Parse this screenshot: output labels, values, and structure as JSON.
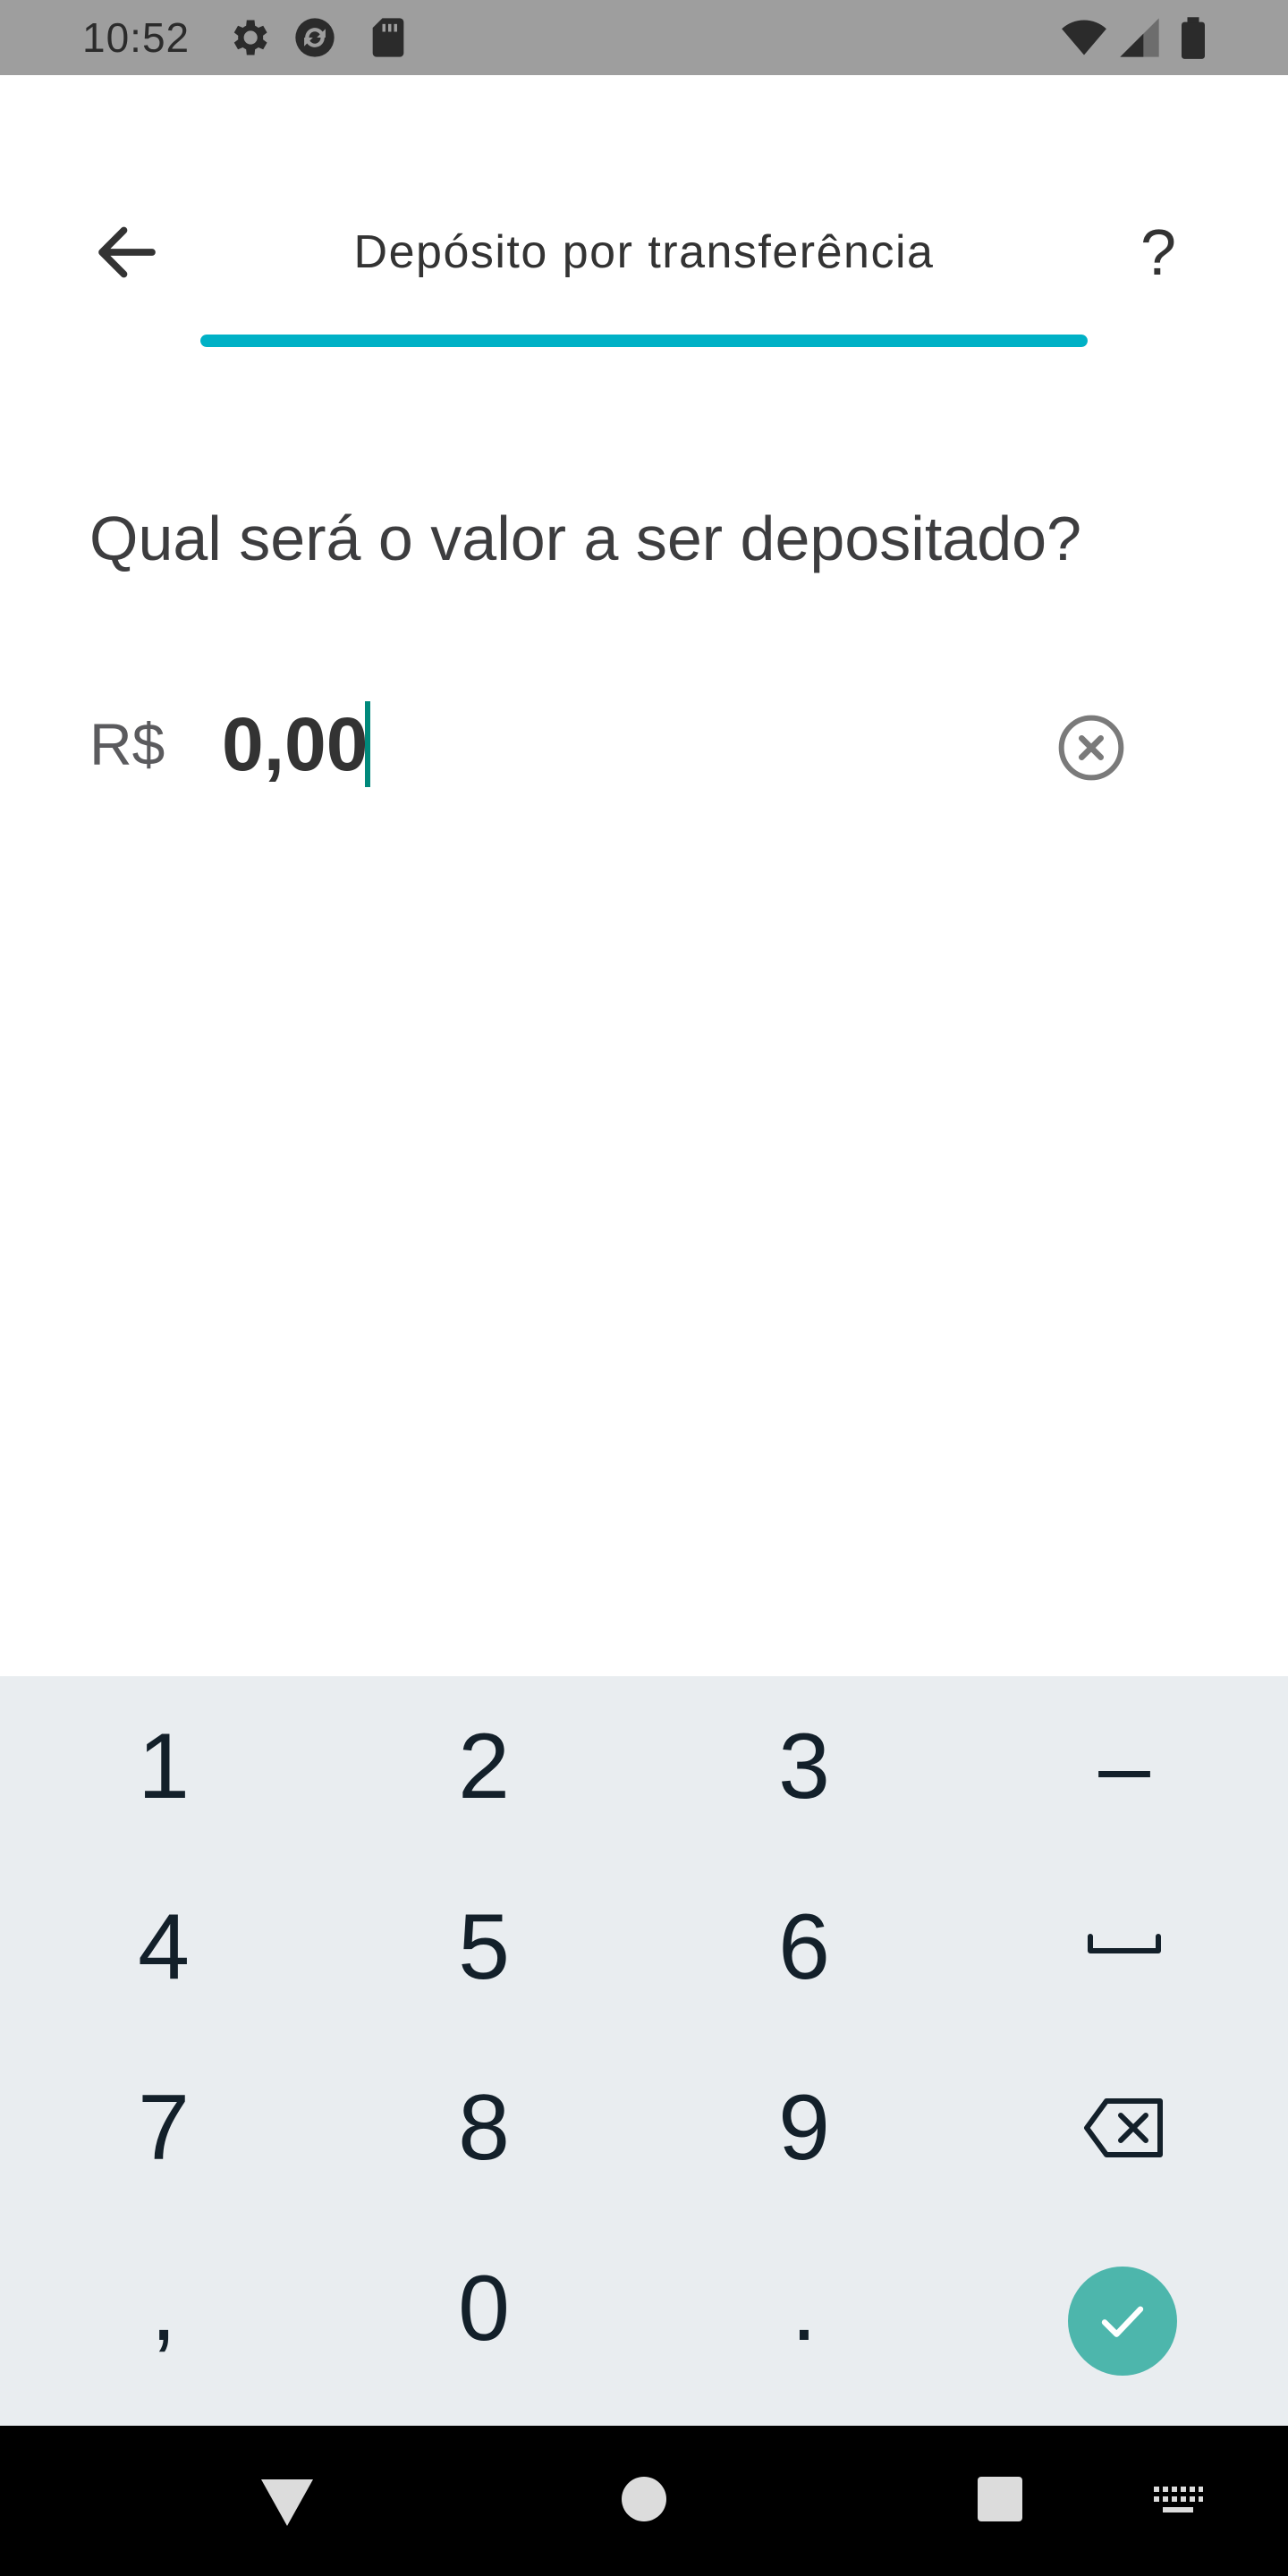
{
  "status_bar": {
    "time": "10:52",
    "icons": [
      "settings-icon",
      "sync-icon",
      "sd-card-icon",
      "wifi-icon",
      "signal-icon",
      "battery-icon"
    ]
  },
  "header": {
    "title": "Depósito por transferência",
    "back_icon": "arrow-left-icon",
    "help_label": "?",
    "progress": 1.0,
    "accent": "#00b1c6"
  },
  "form": {
    "question": "Qual será o valor a ser depositado?",
    "currency": "R$",
    "amount": "0,00",
    "clear_icon": "clear-circle-icon",
    "caret_color": "#00897b"
  },
  "keypad": {
    "keys": [
      "1",
      "2",
      "3",
      "–",
      "4",
      "5",
      "6",
      "␣",
      "7",
      "8",
      "9",
      "⌫",
      ",",
      "0",
      ".",
      "✓"
    ],
    "confirm_color": "#4db6ac",
    "background": "#e9edf0"
  },
  "nav_bar": {
    "icons": [
      "back-triangle-icon",
      "home-circle-icon",
      "recents-square-icon",
      "keyboard-icon"
    ]
  }
}
